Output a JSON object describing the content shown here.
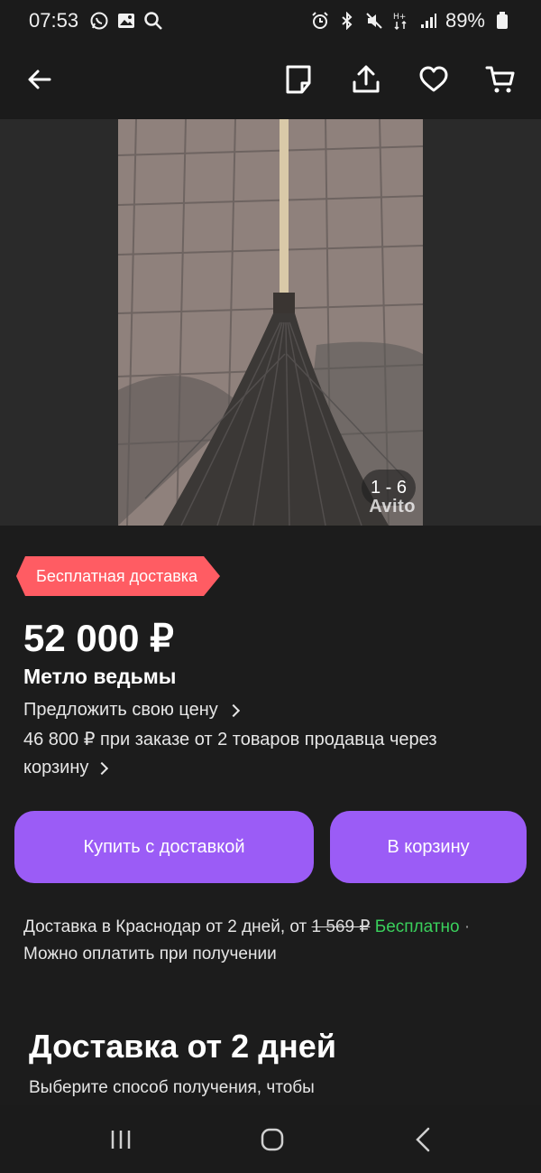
{
  "status_bar": {
    "time": "07:53",
    "left_icons": [
      "whatsapp-icon",
      "gallery-icon",
      "search-icon"
    ],
    "right_icons": [
      "alarm-icon",
      "bluetooth-icon",
      "mute-icon",
      "network-hplus-icon",
      "signal-icon"
    ],
    "battery": "89%"
  },
  "toolbar": {
    "icons": [
      "back-arrow-icon",
      "note-icon",
      "share-icon",
      "favorite-heart-icon",
      "cart-icon"
    ]
  },
  "gallery": {
    "counter": "1 - 6",
    "watermark": "Avito"
  },
  "product": {
    "badge": "Бесплатная доставка",
    "price": "52 000 ₽",
    "title": "Метло ведьмы",
    "offer_link": "Предложить свою цену",
    "bulk_text": "46 800 ₽ при заказе от 2 товаров продавца через корзину"
  },
  "actions": {
    "buy_label": "Купить с доставкой",
    "cart_label": "В корзину"
  },
  "delivery": {
    "prefix": "Доставка в Краснодар от 2 дней, от ",
    "old_price": "1 569 ₽",
    "free": "Бесплатно",
    "separator": " · ",
    "payment": "Можно оплатить при получении"
  },
  "section": {
    "title": "Доставка от 2 дней",
    "text": "Выберите способ получения, чтобы"
  },
  "colors": {
    "accent": "#9b5cf6",
    "badge": "#ff5c63",
    "free": "#3ad05c",
    "background": "#1c1c1c"
  }
}
